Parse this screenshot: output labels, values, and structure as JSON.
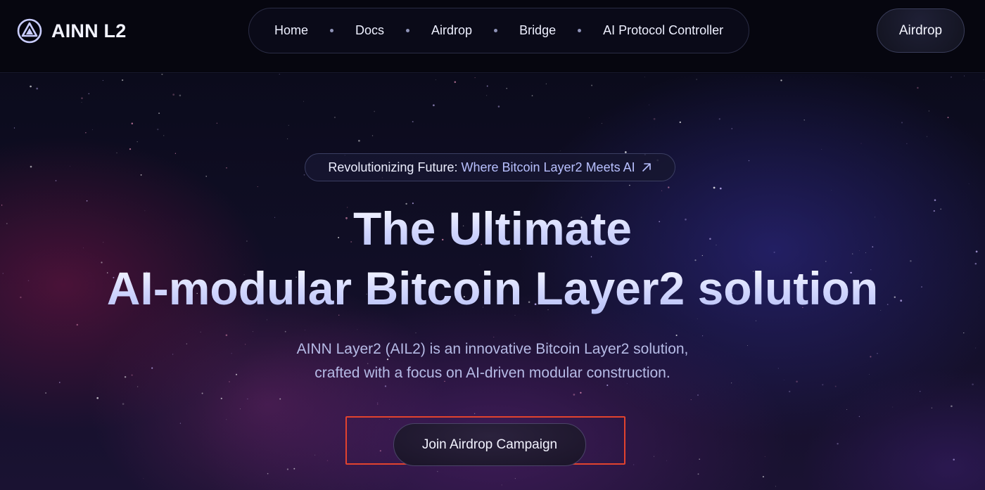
{
  "brand": {
    "name": "AINN L2",
    "icon": "ainn-logo-icon"
  },
  "nav": {
    "items": [
      {
        "label": "Home"
      },
      {
        "label": "Docs"
      },
      {
        "label": "Airdrop"
      },
      {
        "label": "Bridge"
      },
      {
        "label": "AI Protocol Controller"
      }
    ]
  },
  "header": {
    "cta_label": "Airdrop"
  },
  "hero": {
    "badge_lead": "Revolutionizing Future:",
    "badge_accent": "Where Bitcoin Layer2 Meets AI",
    "badge_icon": "arrow-up-right-icon",
    "title_line1": "The Ultimate",
    "title_line2": "AI-modular Bitcoin Layer2 solution",
    "description_line1": "AINN Layer2 (AIL2) is an innovative Bitcoin Layer2 solution,",
    "description_line2": "crafted with a focus on AI-driven modular construction.",
    "cta_label": "Join Airdrop Campaign"
  },
  "colors": {
    "background": "#070712",
    "accent": "#b8c0ff",
    "highlight_box": "#e2432e"
  }
}
